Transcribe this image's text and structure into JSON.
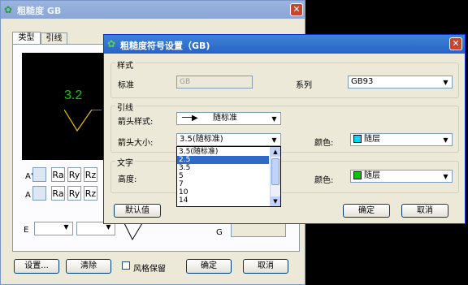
{
  "back": {
    "title": "粗糙度  GB",
    "tabs": [
      "类型",
      "引线"
    ],
    "preview_value": "3.2",
    "row1_label": "A'",
    "row2_label": "A",
    "sym_buttons": [
      "Ra",
      "Ry",
      "Rz"
    ],
    "e_label": "E",
    "g_label": "G",
    "buttons": {
      "setup": "设置...",
      "clear": "清除",
      "style_keep": "风格保留",
      "ok": "确定",
      "cancel": "取消"
    }
  },
  "front": {
    "title": "粗糙度符号设置（GB)",
    "style_group": "样式",
    "standard_label": "标准",
    "standard_value": "GB",
    "series_label": "系列",
    "series_value": "GB93",
    "leader_group": "引线",
    "arrow_style_label": "箭头样式:",
    "arrow_style_value": "随标准",
    "arrow_size_label": "箭头大小:",
    "arrow_size_value": "3.5(随标准)",
    "color_label": "颜色:",
    "leader_color_value": "随层",
    "leader_color_hex": "#00d8ff",
    "text_group": "文字",
    "height_label": "高度:",
    "text_color_label": "颜色:",
    "text_color_value": "随层",
    "text_color_hex": "#00c800",
    "dropdown_options": [
      "3.5(随标准)",
      "2.5",
      "3.5",
      "5",
      "7",
      "10",
      "14"
    ],
    "dropdown_selected": "2.5",
    "buttons": {
      "default": "默认值",
      "ok": "确定",
      "cancel": "取消"
    }
  }
}
